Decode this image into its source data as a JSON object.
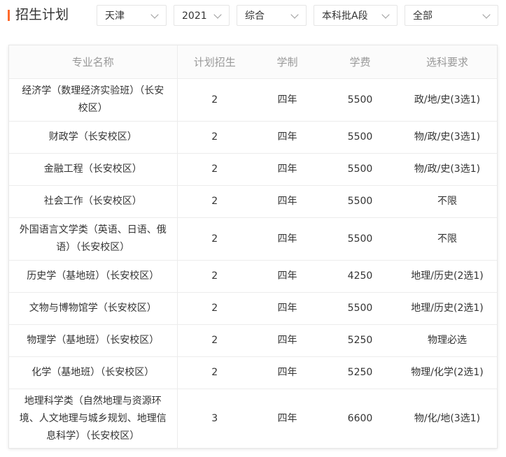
{
  "header": {
    "title": "招生计划",
    "accent_color": "#ff6a2b",
    "filters": [
      {
        "id": "province",
        "value": "天津"
      },
      {
        "id": "year",
        "value": "2021"
      },
      {
        "id": "category",
        "value": "综合"
      },
      {
        "id": "batch",
        "value": "本科批A段"
      },
      {
        "id": "scope",
        "value": "全部"
      }
    ],
    "filter_icon": "chevron-down-icon"
  },
  "table": {
    "headers": [
      "专业名称",
      "计划招生",
      "学制",
      "学费",
      "选科要求"
    ],
    "rows": [
      {
        "major": "经济学（数理经济实验班）（长安校区）",
        "plan": "2",
        "years": "四年",
        "fee": "5500",
        "req": "政/地/史(3选1)"
      },
      {
        "major": "财政学（长安校区）",
        "plan": "2",
        "years": "四年",
        "fee": "5500",
        "req": "物/政/史(3选1)"
      },
      {
        "major": "金融工程（长安校区）",
        "plan": "2",
        "years": "四年",
        "fee": "5500",
        "req": "物/政/史(3选1)"
      },
      {
        "major": "社会工作（长安校区）",
        "plan": "2",
        "years": "四年",
        "fee": "5500",
        "req": "不限"
      },
      {
        "major": "外国语言文学类（英语、日语、俄语）（长安校区）",
        "plan": "2",
        "years": "四年",
        "fee": "5500",
        "req": "不限"
      },
      {
        "major": "历史学（基地班）（长安校区）",
        "plan": "2",
        "years": "四年",
        "fee": "4250",
        "req": "地理/历史(2选1)"
      },
      {
        "major": "文物与博物馆学（长安校区）",
        "plan": "2",
        "years": "四年",
        "fee": "5500",
        "req": "地理/历史(2选1)"
      },
      {
        "major": "物理学（基地班）（长安校区）",
        "plan": "2",
        "years": "四年",
        "fee": "5250",
        "req": "物理必选"
      },
      {
        "major": "化学（基地班）（长安校区）",
        "plan": "2",
        "years": "四年",
        "fee": "5250",
        "req": "物理/化学(2选1)"
      },
      {
        "major": "地理科学类（自然地理与资源环境、人文地理与城乡规划、地理信息科学）（长安校区）",
        "plan": "3",
        "years": "四年",
        "fee": "6600",
        "req": "物/化/地(3选1)"
      }
    ]
  }
}
